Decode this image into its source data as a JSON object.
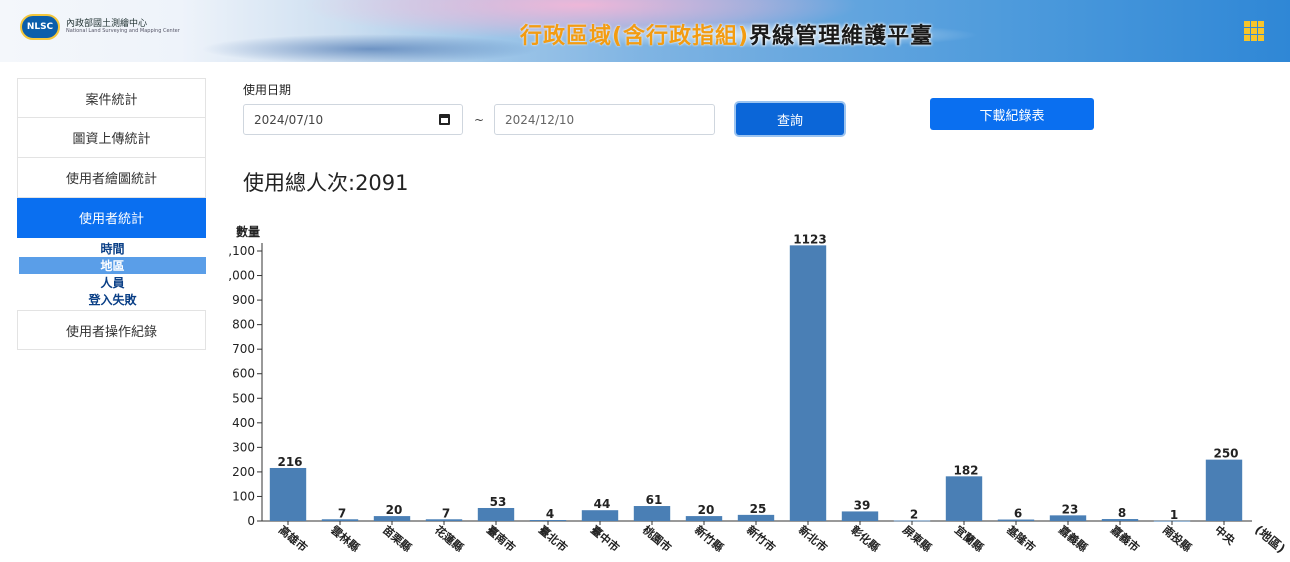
{
  "header": {
    "logo_badge": "NLSC",
    "org_name_cn": "內政部國土測繪中心",
    "org_name_en": "National Land Surveying and Mapping Center",
    "title_highlight": "行政區域(含行政指組)",
    "title_main": "界線管理維護平臺",
    "menu_icon": "grid-icon"
  },
  "sidebar": {
    "items": [
      {
        "label": "案件統計",
        "active": false
      },
      {
        "label": "圖資上傳統計",
        "active": false
      },
      {
        "label": "使用者繪圖統計",
        "active": false
      },
      {
        "label": "使用者統計",
        "active": true
      },
      {
        "label": "使用者操作紀錄",
        "active": false
      }
    ],
    "sub_items": [
      {
        "label": "時間",
        "active": false
      },
      {
        "label": "地區",
        "active": true
      },
      {
        "label": "人員",
        "active": false
      },
      {
        "label": "登入失敗",
        "active": false
      }
    ]
  },
  "filters": {
    "date_label": "使用日期",
    "start_date": "2024/07/10",
    "end_date": "2024/12/10",
    "separator": "~",
    "query_label": "查詢",
    "download_label": "下載紀錄表"
  },
  "summary": {
    "total_text": "使用總人次:2091"
  },
  "chart_data": {
    "type": "bar",
    "ylabel": "數量",
    "xlabel": "(地區)",
    "ylim": [
      0,
      1100
    ],
    "yticks": [
      0,
      100,
      200,
      300,
      400,
      500,
      600,
      700,
      800,
      900,
      1000,
      1100
    ],
    "ytick_labels": [
      "0",
      "100",
      "200",
      "300",
      "400",
      "500",
      "600",
      "700",
      "800",
      "900",
      ",000",
      ",100"
    ],
    "categories": [
      "高雄市",
      "雲林縣",
      "苗栗縣",
      "花蓮縣",
      "臺南市",
      "臺北市",
      "臺中市",
      "桃園市",
      "新竹縣",
      "新竹市",
      "新北市",
      "彰化縣",
      "屏東縣",
      "宜蘭縣",
      "基隆市",
      "嘉義縣",
      "嘉義市",
      "南投縣",
      "中央"
    ],
    "values": [
      216,
      7,
      20,
      7,
      53,
      4,
      44,
      61,
      20,
      25,
      1123,
      39,
      2,
      182,
      6,
      23,
      8,
      1,
      250
    ],
    "bar_color": "#4a7fb5",
    "grid": false
  }
}
